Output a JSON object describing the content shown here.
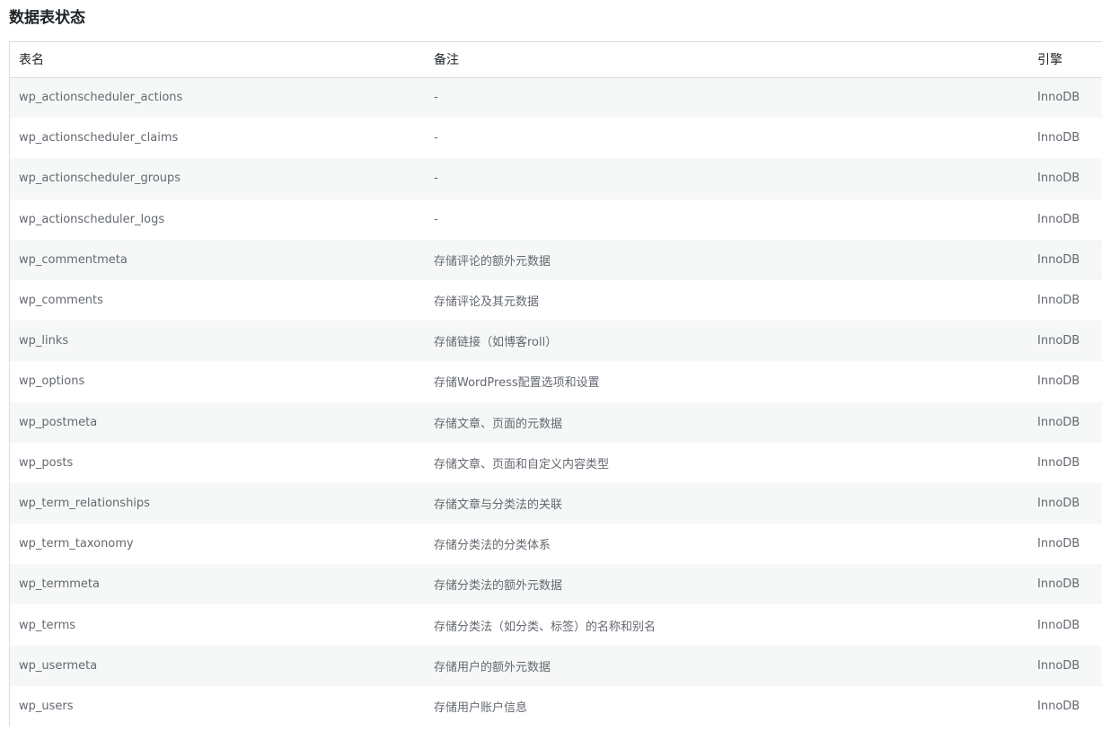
{
  "section": {
    "title": "数据表状态"
  },
  "table": {
    "columns": [
      "表名",
      "备注",
      "引擎"
    ],
    "rows": [
      {
        "name": "wp_actionscheduler_actions",
        "note": "-",
        "engine": "InnoDB"
      },
      {
        "name": "wp_actionscheduler_claims",
        "note": "-",
        "engine": "InnoDB"
      },
      {
        "name": "wp_actionscheduler_groups",
        "note": "-",
        "engine": "InnoDB"
      },
      {
        "name": "wp_actionscheduler_logs",
        "note": "-",
        "engine": "InnoDB"
      },
      {
        "name": "wp_commentmeta",
        "note": "存储评论的额外元数据",
        "engine": "InnoDB"
      },
      {
        "name": "wp_comments",
        "note": "存储评论及其元数据",
        "engine": "InnoDB"
      },
      {
        "name": "wp_links",
        "note": "存储链接（如博客roll）",
        "engine": "InnoDB"
      },
      {
        "name": "wp_options",
        "note": "存储WordPress配置选项和设置",
        "engine": "InnoDB"
      },
      {
        "name": "wp_postmeta",
        "note": "存储文章、页面的元数据",
        "engine": "InnoDB"
      },
      {
        "name": "wp_posts",
        "note": "存储文章、页面和自定义内容类型",
        "engine": "InnoDB"
      },
      {
        "name": "wp_term_relationships",
        "note": "存储文章与分类法的关联",
        "engine": "InnoDB"
      },
      {
        "name": "wp_term_taxonomy",
        "note": "存储分类法的分类体系",
        "engine": "InnoDB"
      },
      {
        "name": "wp_termmeta",
        "note": "存储分类法的额外元数据",
        "engine": "InnoDB"
      },
      {
        "name": "wp_terms",
        "note": "存储分类法（如分类、标签）的名称和别名",
        "engine": "InnoDB"
      },
      {
        "name": "wp_usermeta",
        "note": "存储用户的额外元数据",
        "engine": "InnoDB"
      },
      {
        "name": "wp_users",
        "note": "存储用户账户信息",
        "engine": "InnoDB"
      }
    ]
  }
}
